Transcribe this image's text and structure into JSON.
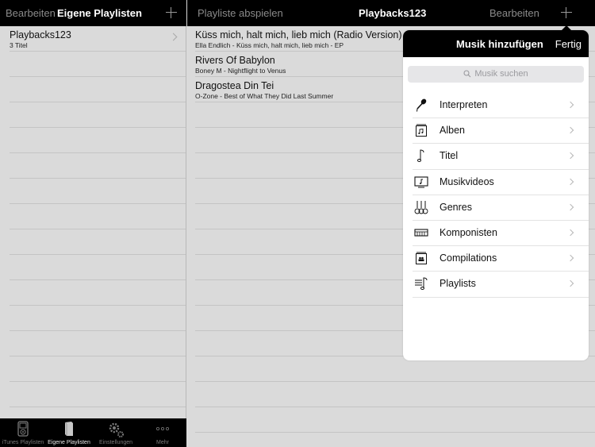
{
  "left_pane": {
    "nav": {
      "edit_label": "Bearbeiten",
      "title": "Eigene Playlisten",
      "add_icon": "plus-icon"
    },
    "playlists": [
      {
        "title": "Playbacks123",
        "subtitle": "3 Titel"
      }
    ],
    "empty_row_count": 14
  },
  "tabbar": {
    "tabs": [
      {
        "label": "iTunes Playlisten",
        "icon": "ipod-icon",
        "active": false
      },
      {
        "label": "Eigene Playlisten",
        "icon": "book-icon",
        "active": true
      },
      {
        "label": "Einstellungen",
        "icon": "gears-icon",
        "active": false
      },
      {
        "label": "Mehr",
        "icon": "more-dots-icon",
        "active": false
      }
    ]
  },
  "right_pane": {
    "nav": {
      "play_label": "Playliste abspielen",
      "title": "Playbacks123",
      "edit_label": "Bearbeiten",
      "add_icon": "plus-icon"
    },
    "songs": [
      {
        "title": "Küss mich, halt mich, lieb mich (Radio Version)",
        "subtitle": "Ella Endlich - Küss mich, halt mich, lieb mich - EP"
      },
      {
        "title": "Rivers Of Babylon",
        "subtitle": "Boney M - Nightflight to Venus"
      },
      {
        "title": "Dragostea Din Tei",
        "subtitle": "O-Zone - Best of What They Did Last Summer"
      }
    ],
    "empty_row_count": 13
  },
  "popover": {
    "title": "Musik hinzufügen",
    "done_label": "Fertig",
    "search_placeholder": "Musik suchen",
    "items": [
      {
        "label": "Interpreten",
        "icon": "microphone-icon"
      },
      {
        "label": "Alben",
        "icon": "album-icon"
      },
      {
        "label": "Titel",
        "icon": "music-note-icon"
      },
      {
        "label": "Musikvideos",
        "icon": "music-video-icon"
      },
      {
        "label": "Genres",
        "icon": "guitars-icon"
      },
      {
        "label": "Komponisten",
        "icon": "keyboard-icon"
      },
      {
        "label": "Compilations",
        "icon": "compilation-icon"
      },
      {
        "label": "Playlists",
        "icon": "playlist-icon"
      }
    ]
  }
}
